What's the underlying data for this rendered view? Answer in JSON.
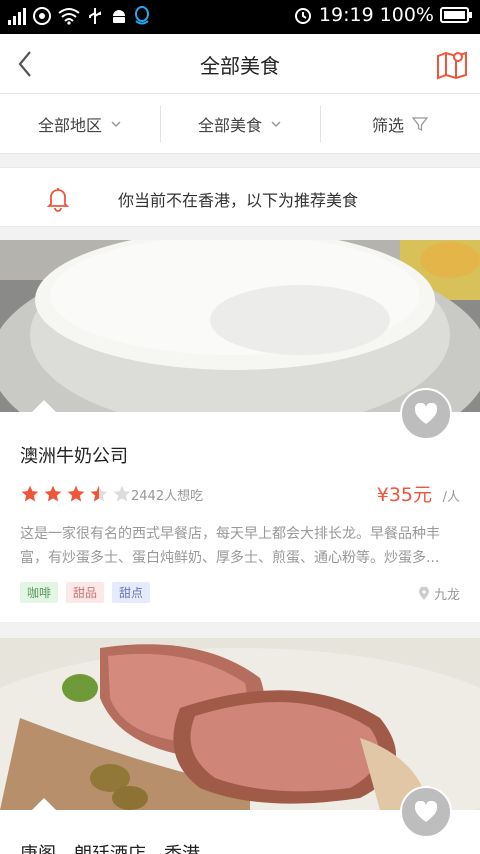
{
  "status": {
    "time": "19:19",
    "battery": "100%"
  },
  "nav": {
    "title": "全部美食"
  },
  "filters": [
    {
      "label": "全部地区"
    },
    {
      "label": "全部美食"
    },
    {
      "label": "筛选"
    }
  ],
  "notice": {
    "text": "你当前不在香港，以下为推荐美食"
  },
  "cards": [
    {
      "name": "澳洲牛奶公司",
      "rating": 3.5,
      "want": "2442人想吃",
      "price": "¥35元",
      "per": "/人",
      "desc": "这是一家很有名的西式早餐店，每天早上都会大排长龙。早餐品种丰富，有炒蛋多士、蛋白炖鲜奶、厚多士、煎蛋、通心粉等。炒蛋多...",
      "tags": [
        "咖啡",
        "甜品",
        "甜点"
      ],
      "location": "九龙"
    },
    {
      "name": "唐阁 - 朗廷酒店，香港"
    }
  ],
  "colors": {
    "accent": "#f0553a",
    "star": "#f0553a"
  }
}
